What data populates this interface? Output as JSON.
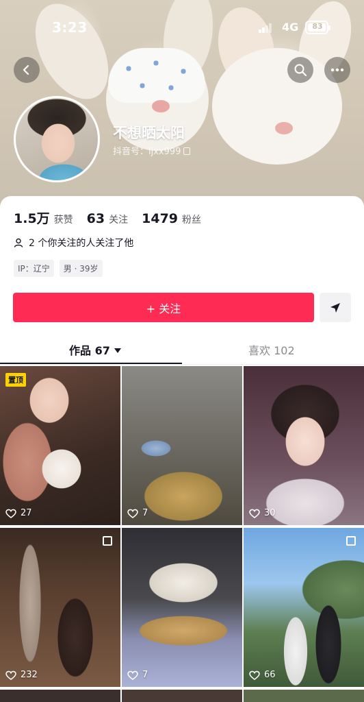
{
  "status_bar": {
    "time": "3:23",
    "network": "4G",
    "battery": "83"
  },
  "profile": {
    "nickname": "不想晒太阳",
    "account_id": "抖音号：ljxx999"
  },
  "stats": [
    {
      "value": "1.5万",
      "label": "获赞"
    },
    {
      "value": "63",
      "label": "关注"
    },
    {
      "value": "1479",
      "label": "粉丝"
    }
  ],
  "mutual_text": "2 个你关注的人关注了他",
  "tags": [
    "IP：辽宁",
    "男 · 39岁"
  ],
  "follow_label": "+ 关注",
  "tabs": {
    "works": "作品 67",
    "likes": "喜欢 102"
  },
  "pinned_label": "置顶",
  "videos": [
    {
      "likes": "27",
      "pinned": true
    },
    {
      "likes": "7"
    },
    {
      "likes": "30"
    },
    {
      "likes": "232",
      "multi": true
    },
    {
      "likes": "7"
    },
    {
      "likes": "66",
      "multi": true
    }
  ],
  "colors": {
    "accent": "#fe2c55",
    "pin": "#fdd200"
  },
  "icons": [
    "back-icon",
    "search-icon",
    "more-icon",
    "copy-icon",
    "user-icon",
    "share-icon",
    "heart-icon",
    "multi-image-icon"
  ]
}
